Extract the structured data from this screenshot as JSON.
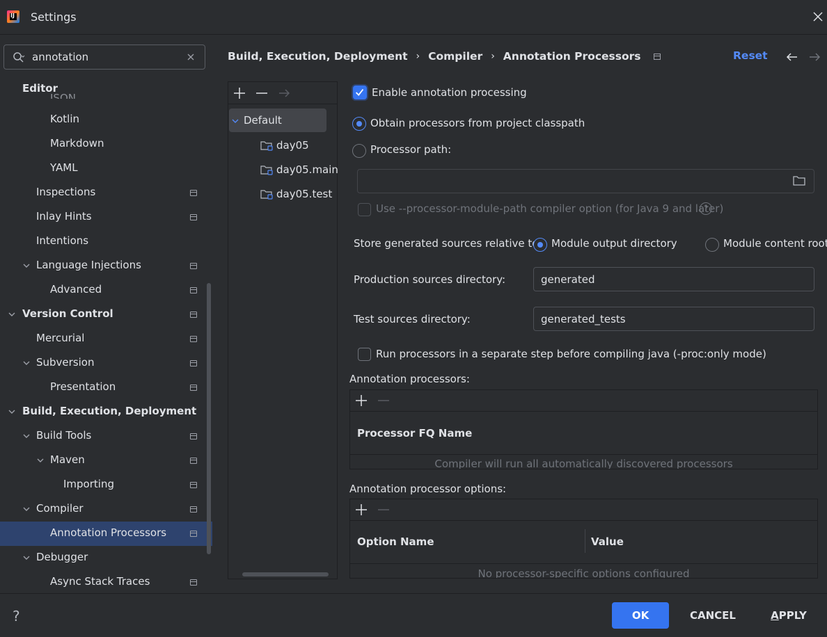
{
  "window": {
    "title": "Settings",
    "logo_text": "IJ"
  },
  "search": {
    "value": "annotation",
    "placeholder": ""
  },
  "tree": {
    "editor_partial": "JSON",
    "items": [
      {
        "label": "Editor",
        "bold": true
      },
      {
        "label": "Kotlin"
      },
      {
        "label": "Markdown"
      },
      {
        "label": "YAML"
      },
      {
        "label": "Inspections"
      },
      {
        "label": "Inlay Hints"
      },
      {
        "label": "Intentions"
      },
      {
        "label": "Language Injections"
      },
      {
        "label": "Advanced"
      },
      {
        "label": "Version Control",
        "bold": true
      },
      {
        "label": "Mercurial"
      },
      {
        "label": "Subversion"
      },
      {
        "label": "Presentation"
      },
      {
        "label": "Build, Execution, Deployment",
        "bold": true
      },
      {
        "label": "Build Tools"
      },
      {
        "label": "Maven"
      },
      {
        "label": "Importing"
      },
      {
        "label": "Compiler"
      },
      {
        "label": "Annotation Processors",
        "selected": true
      },
      {
        "label": "Debugger"
      },
      {
        "label": "Async Stack Traces"
      }
    ]
  },
  "breadcrumb": {
    "items": [
      "Build, Execution, Deployment",
      "Compiler",
      "Annotation Processors"
    ],
    "separator": "›",
    "reset_label": "Reset"
  },
  "profiles": {
    "items": [
      {
        "label": "Default",
        "selected": true
      },
      {
        "label": "day05"
      },
      {
        "label": "day05.main"
      },
      {
        "label": "day05.test"
      }
    ]
  },
  "settings": {
    "enable_processing": {
      "label": "Enable annotation processing",
      "checked": true
    },
    "obtain_classpath": {
      "label": "Obtain processors from project classpath",
      "checked": true
    },
    "processor_path": {
      "label": "Processor path:",
      "value": ""
    },
    "module_path_option": {
      "label": "Use --processor-module-path compiler option (for Java 9 and later)",
      "checked": false
    },
    "help_glyph": "?",
    "store_relative_label": "Store generated sources relative to:",
    "module_output": {
      "label": "Module output directory",
      "checked": true
    },
    "module_content_root": {
      "label": "Module content root",
      "checked": false
    },
    "production_dir": {
      "label": "Production sources directory:",
      "value": "generated"
    },
    "test_dir": {
      "label": "Test sources directory:",
      "value": "generated_tests"
    },
    "separate_step": {
      "label": "Run processors in a separate step before compiling java (-proc:only mode)",
      "checked": false
    }
  },
  "processors_table": {
    "title": "Annotation processors:",
    "column": "Processor FQ Name",
    "empty_text": "Compiler will run all automatically discovered processors"
  },
  "options_table": {
    "title": "Annotation processor options:",
    "columns": [
      "Option Name",
      "Value"
    ],
    "empty_text": "No processor-specific options configured"
  },
  "footer": {
    "help_label": "?",
    "ok_label": "OK",
    "cancel_label": "CANCEL",
    "apply_mnemonic": "A",
    "apply_rest": "PPLY"
  },
  "colors": {
    "background": "#2b2d30",
    "accent": "#3574f0",
    "link": "#548af7",
    "selection": "#2e436e",
    "text": "#dfe1e5",
    "disabled_text": "#6f737a"
  }
}
